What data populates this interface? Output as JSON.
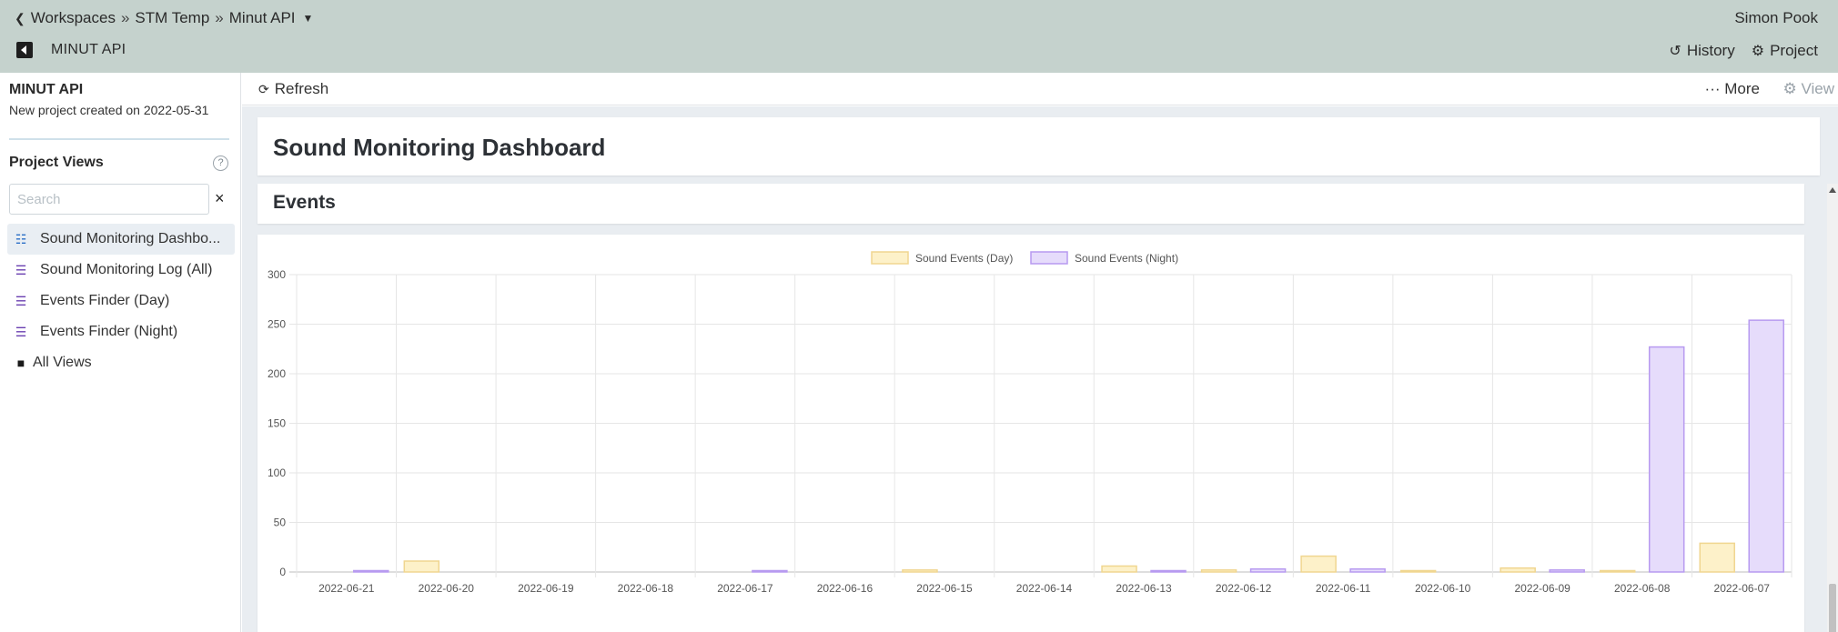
{
  "breadcrumb": {
    "items": [
      "Workspaces",
      "STM Temp",
      "Minut API"
    ],
    "separator": "»"
  },
  "user": {
    "name": "Simon Pook"
  },
  "project_bar": {
    "title": "MINUT API",
    "history_label": "History",
    "project_label": "Project"
  },
  "sidebar": {
    "project_name": "MINUT API",
    "project_desc": "New project created on 2022-05-31",
    "views_heading": "Project Views",
    "help_glyph": "?",
    "search_placeholder": "Search",
    "clear_glyph": "×",
    "items": [
      {
        "label": "Sound Monitoring Dashbo...",
        "icon": "bar-chart-icon",
        "active": true
      },
      {
        "label": "Sound Monitoring Log (All)",
        "icon": "list-icon",
        "active": false
      },
      {
        "label": "Events Finder (Day)",
        "icon": "list-icon",
        "active": false
      },
      {
        "label": "Events Finder (Night)",
        "icon": "list-icon",
        "active": false
      },
      {
        "label": "All Views",
        "icon": "folder-icon",
        "active": false
      }
    ]
  },
  "toolbar": {
    "refresh_label": "Refresh",
    "more_label": "More",
    "view_label": "View"
  },
  "dashboard": {
    "title": "Sound Monitoring Dashboard",
    "section_title": "Events"
  },
  "colors": {
    "day_fill": "#fdf1c9",
    "day_stroke": "#f0d690",
    "night_fill": "#e6dcfb",
    "night_stroke": "#b79af0",
    "topbar": "#c5d2cd"
  },
  "chart_data": {
    "type": "bar",
    "categories": [
      "2022-06-21",
      "2022-06-20",
      "2022-06-19",
      "2022-06-18",
      "2022-06-17",
      "2022-06-16",
      "2022-06-15",
      "2022-06-14",
      "2022-06-13",
      "2022-06-12",
      "2022-06-11",
      "2022-06-10",
      "2022-06-09",
      "2022-06-08",
      "2022-06-07"
    ],
    "series": [
      {
        "name": "Sound Events (Day)",
        "values": [
          0,
          11,
          0,
          0,
          0,
          0,
          2,
          0,
          6,
          2,
          16,
          1,
          4,
          1,
          29
        ]
      },
      {
        "name": "Sound Events (Night)",
        "values": [
          1,
          0,
          0,
          0,
          1,
          0,
          0,
          0,
          1,
          3,
          3,
          0,
          2,
          227,
          254
        ]
      }
    ],
    "ylim": [
      0,
      300
    ],
    "yticks": [
      0,
      50,
      100,
      150,
      200,
      250,
      300
    ],
    "legend": "top-center",
    "grid": true
  }
}
